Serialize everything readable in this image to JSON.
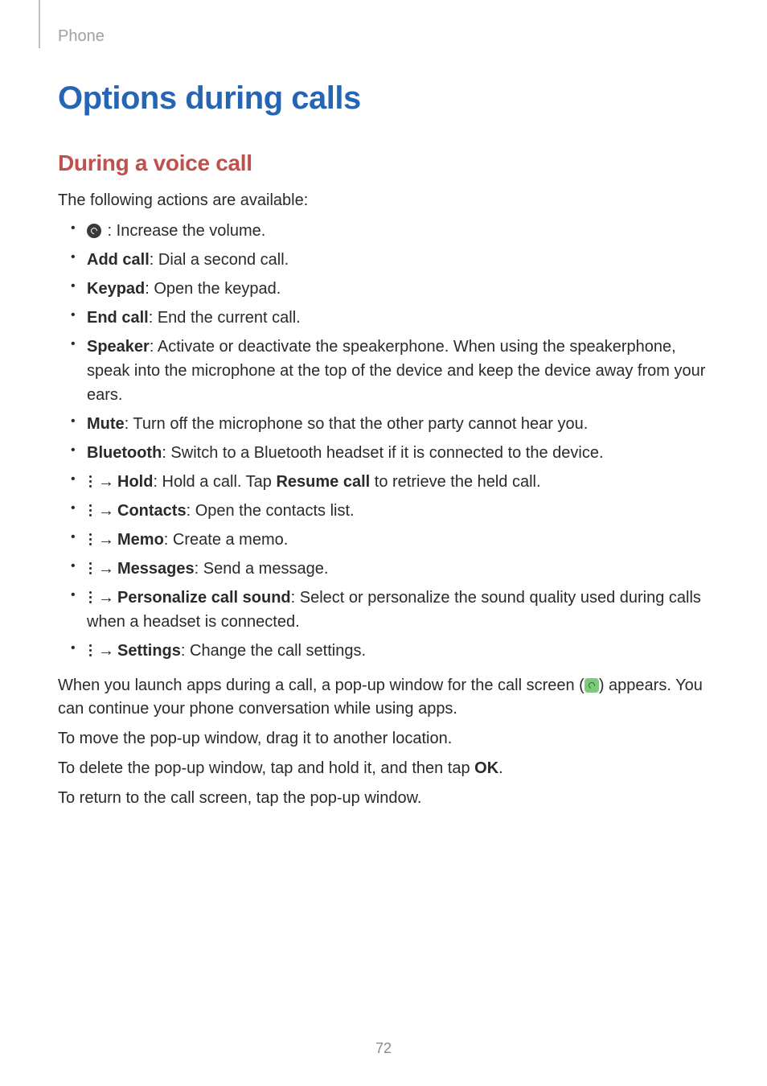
{
  "header": {
    "section": "Phone"
  },
  "page": {
    "title": "Options during calls",
    "subtitle": "During a voice call",
    "intro": "The following actions are available:",
    "number": "72"
  },
  "items": {
    "volume": {
      "desc": " : Increase the volume."
    },
    "addcall": {
      "label": "Add call",
      "desc": ": Dial a second call."
    },
    "keypad": {
      "label": "Keypad",
      "desc": ": Open the keypad."
    },
    "endcall": {
      "label": "End call",
      "desc": ": End the current call."
    },
    "speaker": {
      "label": "Speaker",
      "desc": ": Activate or deactivate the speakerphone. When using the speakerphone, speak into the microphone at the top of the device and keep the device away from your ears."
    },
    "mute": {
      "label": "Mute",
      "desc": ": Turn off the microphone so that the other party cannot hear you."
    },
    "bluetooth": {
      "label": "Bluetooth",
      "desc": ": Switch to a Bluetooth headset if it is connected to the device."
    },
    "hold": {
      "label": "Hold",
      "desc_a": ": Hold a call. Tap ",
      "resume": "Resume call",
      "desc_b": " to retrieve the held call."
    },
    "contacts": {
      "label": "Contacts",
      "desc": ": Open the contacts list."
    },
    "memo": {
      "label": "Memo",
      "desc": ": Create a memo."
    },
    "messages": {
      "label": "Messages",
      "desc": ": Send a message."
    },
    "personalize": {
      "label": "Personalize call sound",
      "desc": ": Select or personalize the sound quality used during calls when a headset is connected."
    },
    "settings": {
      "label": "Settings",
      "desc": ": Change the call settings."
    }
  },
  "footer": {
    "p1a": "When you launch apps during a call, a pop-up window for the call screen (",
    "p1b": ") appears. You can continue your phone conversation while using apps.",
    "p2": "To move the pop-up window, drag it to another location.",
    "p3a": "To delete the pop-up window, tap and hold it, and then tap ",
    "p3ok": "OK",
    "p3b": ".",
    "p4": "To return to the call screen, tap the pop-up window."
  },
  "glyphs": {
    "arrow": "→"
  }
}
